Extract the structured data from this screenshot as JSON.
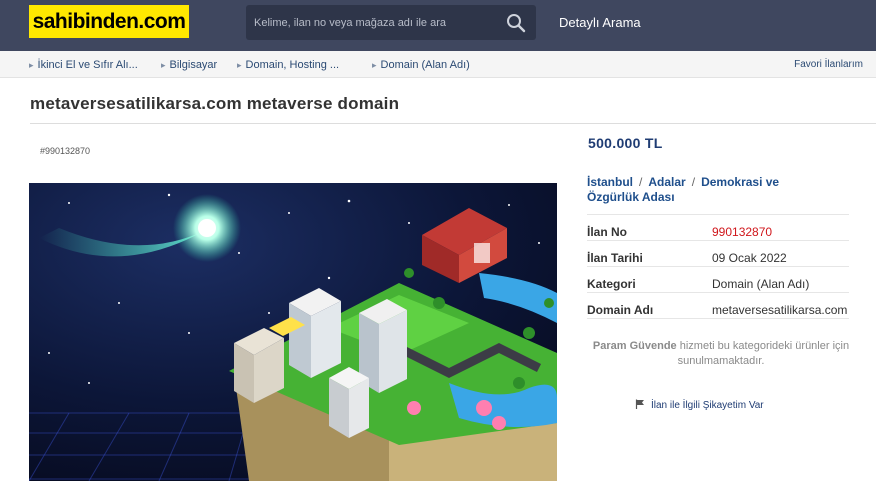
{
  "header": {
    "logo_text": "sahibinden.com",
    "search_placeholder": "Kelime, ilan no veya mağaza adı ile ara",
    "advanced_search_label": "Detaylı Arama"
  },
  "breadcrumb": {
    "items": [
      {
        "label": "İkinci El ve Sıfır Alı..."
      },
      {
        "label": "Bilgisayar"
      },
      {
        "label": "Domain, Hosting ..."
      },
      {
        "label": "Domain (Alan Adı)"
      }
    ],
    "favorites_label": "Favori İlanlarım"
  },
  "listing": {
    "title": "metaversesatilikarsa.com metaverse domain",
    "id_tag": "#990132870",
    "image_watermark": "sahibinden.com",
    "price": "500.000 TL",
    "location": {
      "city": "İstanbul",
      "district": "Adalar",
      "area": "Demokrasi ve Özgürlük Adası",
      "separator": "/"
    },
    "details": [
      {
        "key": "İlan No",
        "value": "990132870",
        "highlight": true
      },
      {
        "key": "İlan Tarihi",
        "value": "09 Ocak 2022",
        "highlight": false
      },
      {
        "key": "Kategori",
        "value": "Domain (Alan Adı)",
        "highlight": false
      },
      {
        "key": "Domain Adı",
        "value": "metaversesatilikarsa.com",
        "highlight": false
      }
    ],
    "param_guvende_brand": "Param Güvende",
    "param_guvende_text": " hizmeti bu kategorideki ürünler için sunulmamaktadır.",
    "complaint_label": "İlan ile İlgili Şikayetim Var"
  },
  "colors": {
    "header_bg": "#3f475f",
    "logo_bg": "#ffe800",
    "link_blue": "#1f4f8c",
    "id_red": "#d0161b"
  },
  "icons": {
    "search": "search-icon",
    "flag": "flag-icon",
    "breadcrumb_arrow": "chevron-right-icon"
  }
}
